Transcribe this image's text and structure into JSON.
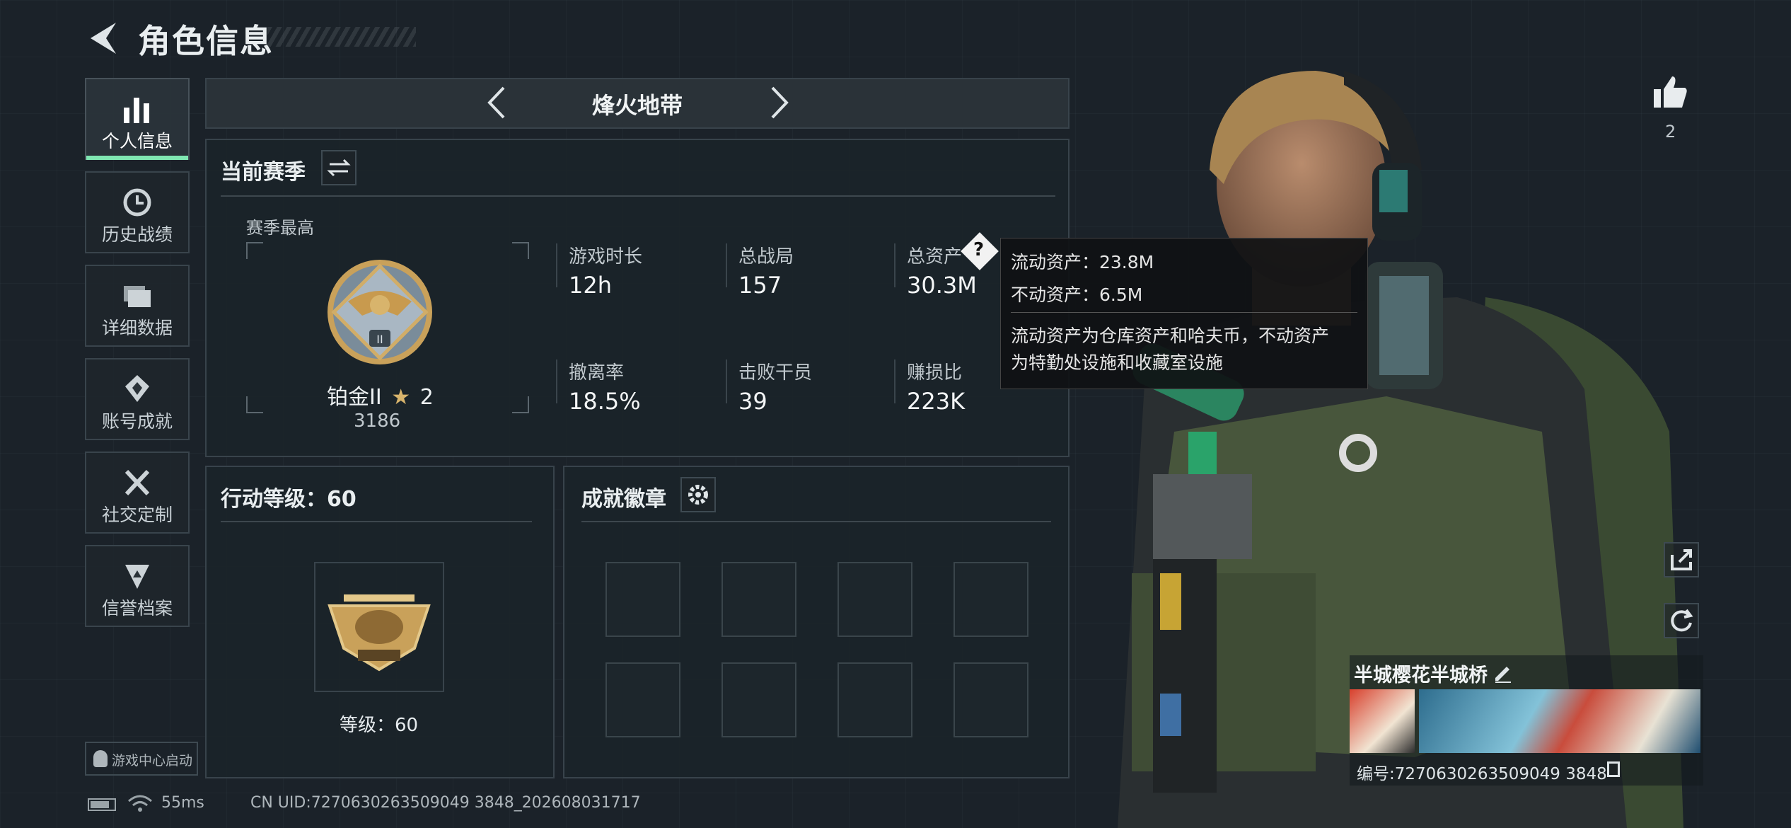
{
  "header": {
    "title": "角色信息"
  },
  "sidebar": {
    "items": [
      {
        "label": "个人信息",
        "icon": "bar-chart-icon",
        "active": true
      },
      {
        "label": "历史战绩",
        "icon": "history-icon"
      },
      {
        "label": "详细数据",
        "icon": "folder-icon"
      },
      {
        "label": "账号成就",
        "icon": "achievement-icon"
      },
      {
        "label": "社交定制",
        "icon": "tools-icon"
      },
      {
        "label": "信誉档案",
        "icon": "credibility-icon"
      }
    ],
    "game_center": "游戏中心启动"
  },
  "mode_tab": {
    "title": "烽火地带"
  },
  "season": {
    "title": "当前赛季",
    "best_label": "赛季最高",
    "rank_name": "铂金II",
    "rank_stars": "2",
    "rank_points": "3186",
    "stats": [
      {
        "label": "游戏时长",
        "value": "12h"
      },
      {
        "label": "总战局",
        "value": "157"
      },
      {
        "label": "总资产",
        "value": "30.3M"
      },
      {
        "label": "撤离率",
        "value": "18.5%"
      },
      {
        "label": "击败干员",
        "value": "39"
      },
      {
        "label": "赚损比",
        "value": "223K"
      }
    ]
  },
  "tooltip": {
    "liquid": "流动资产：23.8M",
    "fixed": "不动资产：6.5M",
    "desc_line1": "流动资产为仓库资产和哈夫币，不动资产",
    "desc_line2": "为特勤处设施和收藏室设施"
  },
  "action_level": {
    "title": "行动等级：60",
    "level_text": "等级：60"
  },
  "achievements": {
    "title": "成就徽章",
    "slots": 8
  },
  "profile": {
    "likes": "2",
    "name": "半城樱花半城桥",
    "id_text": "编号:7270630263509049 3848"
  },
  "status_bar": {
    "ping": "55ms",
    "uid": "CN UID:7270630263509049 3848_202608031717"
  },
  "colors": {
    "accent": "#7fe7b2",
    "bg": "#1b2229"
  }
}
